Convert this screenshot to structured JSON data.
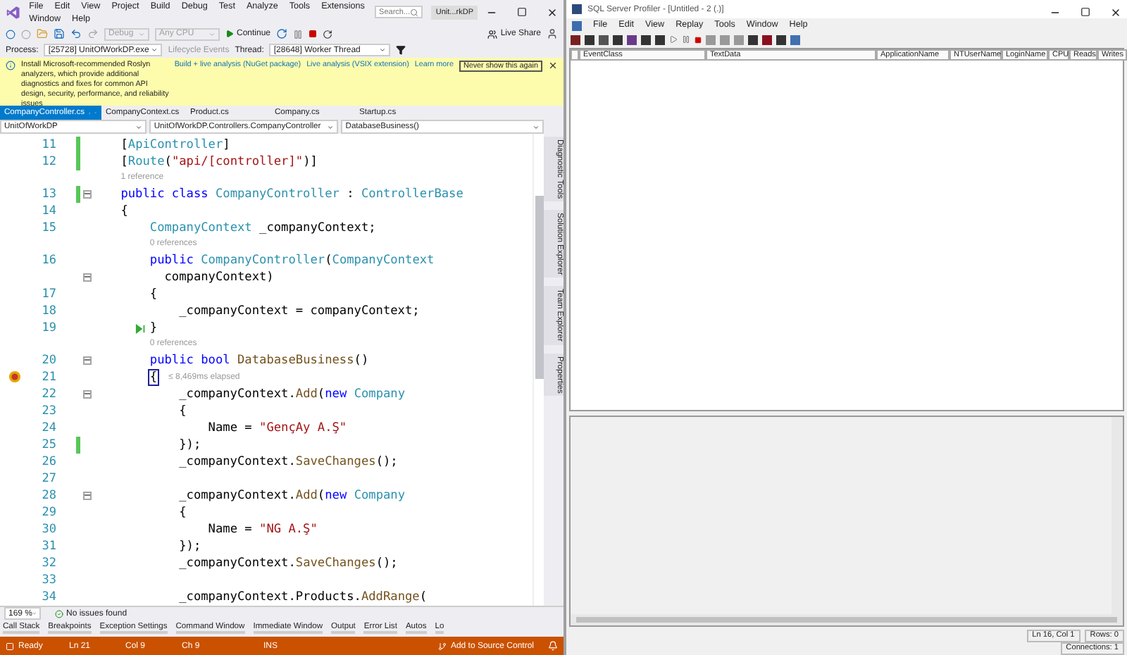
{
  "vs": {
    "menu": [
      "File",
      "Edit",
      "View",
      "Project",
      "Build",
      "Debug",
      "Test",
      "Analyze",
      "Tools",
      "Extensions",
      "Window",
      "Help"
    ],
    "search": {
      "placeholder": "Search..."
    },
    "solution_badge": "Unit...rkDP",
    "toolbar": {
      "configuration": {
        "value": "Debug",
        "disabled": true
      },
      "platform": {
        "value": "Any CPU",
        "disabled": true
      },
      "continue": "Continue",
      "live_share": "Live Share"
    },
    "debug_location": {
      "process_label": "Process:",
      "process": "[25728] UnitOfWorkDP.exe",
      "lifecycle": "Lifecycle Events",
      "thread_label": "Thread:",
      "thread": "[28648] Worker Thread"
    },
    "info_bar": {
      "message": "Install Microsoft-recommended Roslyn analyzers, which provide additional diagnostics and fixes for common API design, security, performance, and reliability issues",
      "links": [
        "Build + live analysis (NuGet package)",
        "Live analysis (VSIX extension)",
        "Learn more"
      ],
      "button": "Never show this again"
    },
    "tabs": [
      {
        "label": "CompanyController.cs",
        "selected": true
      },
      {
        "label": "CompanyContext.cs",
        "selected": false
      },
      {
        "label": "Product.cs",
        "selected": false
      },
      {
        "label": "Company.cs",
        "selected": false
      },
      {
        "label": "Startup.cs",
        "selected": false
      }
    ],
    "nav": [
      "UnitOfWorkDP",
      "UnitOfWorkDP.Controllers.CompanyController",
      "DatabaseBusiness()"
    ],
    "side_tabs": [
      "Diagnostic Tools",
      "Solution Explorer",
      "Team Explorer",
      "Properties"
    ],
    "code": [
      {
        "kind": "code",
        "number": "11",
        "changed": true,
        "segments": [
          {
            "kind": "plain",
            "text": "    ["
          },
          {
            "kind": "type",
            "text": "ApiController"
          },
          {
            "kind": "plain",
            "text": "]"
          }
        ]
      },
      {
        "kind": "code",
        "number": "12",
        "changed": true,
        "segments": [
          {
            "kind": "plain",
            "text": "    ["
          },
          {
            "kind": "type",
            "text": "Route"
          },
          {
            "kind": "plain",
            "text": "("
          },
          {
            "kind": "string",
            "text": "\"api/[controller]\""
          },
          {
            "kind": "plain",
            "text": ")]"
          }
        ]
      },
      {
        "kind": "lens",
        "text": "1 reference"
      },
      {
        "kind": "code",
        "number": "13",
        "changed": true,
        "collapsible": true,
        "segments": [
          {
            "kind": "keyword",
            "text": "    public class "
          },
          {
            "kind": "type",
            "text": "CompanyController"
          },
          {
            "kind": "plain",
            "text": " : "
          },
          {
            "kind": "type",
            "text": "ControllerBase"
          }
        ]
      },
      {
        "kind": "code",
        "number": "14",
        "segments": [
          {
            "kind": "plain",
            "text": "    {"
          }
        ]
      },
      {
        "kind": "code",
        "number": "15",
        "segments": [
          {
            "kind": "type",
            "text": "        CompanyContext"
          },
          {
            "kind": "plain",
            "text": " _companyContext;"
          }
        ]
      },
      {
        "kind": "lens",
        "text": "0 references"
      },
      {
        "kind": "code",
        "number": "16",
        "segments": [
          {
            "kind": "keyword",
            "text": "        public "
          },
          {
            "kind": "type",
            "text": "CompanyController"
          },
          {
            "kind": "plain",
            "text": "("
          },
          {
            "kind": "type",
            "text": "CompanyContext"
          }
        ]
      },
      {
        "kind": "wrap",
        "collapsible": true,
        "segments": [
          {
            "kind": "plain",
            "text": "          companyContext)"
          }
        ]
      },
      {
        "kind": "code",
        "number": "17",
        "segments": [
          {
            "kind": "plain",
            "text": "        {"
          }
        ]
      },
      {
        "kind": "code",
        "number": "18",
        "segments": [
          {
            "kind": "plain",
            "text": "            _companyContext = companyContext;"
          }
        ]
      },
      {
        "kind": "code",
        "number": "19",
        "run_to_click": true,
        "segments": [
          {
            "kind": "plain",
            "text": "        }"
          }
        ]
      },
      {
        "kind": "lens",
        "text": "0 references"
      },
      {
        "kind": "code",
        "number": "20",
        "collapsible": true,
        "segments": [
          {
            "kind": "keyword",
            "text": "        public bool "
          },
          {
            "kind": "method",
            "text": "DatabaseBusiness"
          },
          {
            "kind": "plain",
            "text": "()"
          }
        ]
      },
      {
        "kind": "code",
        "number": "21",
        "current": true,
        "hint": "≤ 8,469ms elapsed",
        "segments": [
          {
            "kind": "current_brace",
            "text": "        {"
          }
        ]
      },
      {
        "kind": "code",
        "number": "22",
        "collapsible": true,
        "segments": [
          {
            "kind": "plain",
            "text": "            _companyContext."
          },
          {
            "kind": "method",
            "text": "Add"
          },
          {
            "kind": "plain",
            "text": "("
          },
          {
            "kind": "keyword",
            "text": "new "
          },
          {
            "kind": "type",
            "text": "Company"
          }
        ]
      },
      {
        "kind": "code",
        "number": "23",
        "segments": [
          {
            "kind": "plain",
            "text": "            {"
          }
        ]
      },
      {
        "kind": "code",
        "number": "24",
        "segments": [
          {
            "kind": "plain",
            "text": "                Name = "
          },
          {
            "kind": "string",
            "text": "\"GençAy A.Ş\""
          }
        ]
      },
      {
        "kind": "code",
        "number": "25",
        "changed": true,
        "segments": [
          {
            "kind": "plain",
            "text": "            });"
          }
        ]
      },
      {
        "kind": "code",
        "number": "26",
        "segments": [
          {
            "kind": "plain",
            "text": "            _companyContext."
          },
          {
            "kind": "method",
            "text": "SaveChanges"
          },
          {
            "kind": "plain",
            "text": "();"
          }
        ]
      },
      {
        "kind": "code",
        "number": "27"
      },
      {
        "kind": "code",
        "number": "28",
        "collapsible": true,
        "segments": [
          {
            "kind": "plain",
            "text": "            _companyContext."
          },
          {
            "kind": "method",
            "text": "Add"
          },
          {
            "kind": "plain",
            "text": "("
          },
          {
            "kind": "keyword",
            "text": "new "
          },
          {
            "kind": "type",
            "text": "Company"
          }
        ]
      },
      {
        "kind": "code",
        "number": "29",
        "segments": [
          {
            "kind": "plain",
            "text": "            {"
          }
        ]
      },
      {
        "kind": "code",
        "number": "30",
        "segments": [
          {
            "kind": "plain",
            "text": "                Name = "
          },
          {
            "kind": "string",
            "text": "\"NG A.Ş\""
          }
        ]
      },
      {
        "kind": "code",
        "number": "31",
        "segments": [
          {
            "kind": "plain",
            "text": "            });"
          }
        ]
      },
      {
        "kind": "code",
        "number": "32",
        "segments": [
          {
            "kind": "plain",
            "text": "            _companyContext."
          },
          {
            "kind": "method",
            "text": "SaveChanges"
          },
          {
            "kind": "plain",
            "text": "();"
          }
        ]
      },
      {
        "kind": "code",
        "number": "33"
      },
      {
        "kind": "code",
        "number": "34",
        "segments": [
          {
            "kind": "plain",
            "text": "            _companyContext.Products."
          },
          {
            "kind": "method",
            "text": "AddRange"
          },
          {
            "kind": "plain",
            "text": "("
          }
        ]
      }
    ],
    "zoom": "169 %",
    "issues": "No issues found",
    "tool_tabs": [
      "Call Stack",
      "Breakpoints",
      "Exception Settings",
      "Command Window",
      "Immediate Window",
      "Output",
      "Error List",
      "Autos",
      "Lo"
    ],
    "status": {
      "state": "Ready",
      "ln": "Ln 21",
      "col": "Col 9",
      "ch": "Ch 9",
      "mode": "INS",
      "source_control": "Add to Source Control"
    }
  },
  "profiler": {
    "title": "SQL Server Profiler - [Untitled - 2 (.)]",
    "menu": [
      "File",
      "Edit",
      "View",
      "Replay",
      "Tools",
      "Window",
      "Help"
    ],
    "columns": [
      "EventClass",
      "TextData",
      "ApplicationName",
      "NTUserName",
      "LoginName",
      "CPU",
      "Reads",
      "Writes"
    ],
    "status": {
      "position": "Ln 16, Col 1",
      "rows": "Rows: 0",
      "connections": "Connections: 1"
    }
  }
}
